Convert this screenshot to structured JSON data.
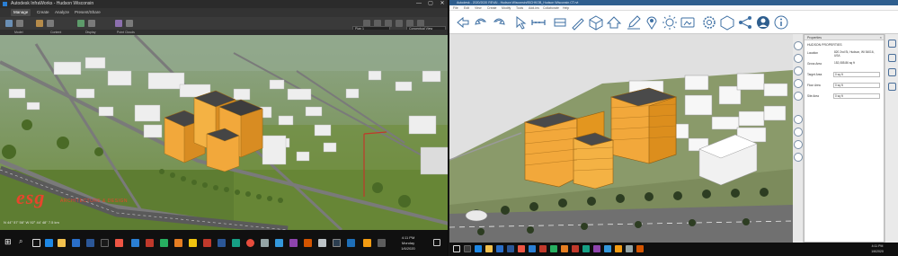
{
  "left_window": {
    "title": "Autodesk InfraWorks - Hudson Wisconsin",
    "tabs": [
      "Manage",
      "Create",
      "Analyze",
      "Present/Share"
    ],
    "ribbon_groups": [
      "Model",
      "Content",
      "Display",
      "Point Clouds"
    ],
    "view_select": "Plan 1",
    "style_select": "Conceptual View",
    "logo_text": "esg",
    "logo_subtitle": "ARCHITECTURE & DESIGN",
    "status_text": "N 44° 57' 56\" W 92° 44' 48\" 7.5 km",
    "clock_time": "4:11 PM",
    "clock_day": "Monday",
    "clock_date": "1/6/2020"
  },
  "right_window": {
    "title": "Autodesk - 2020/2020 REVAI - Hudson Wisconsin/IBCHKOB_Hudson Wisconsin.CT.rvt",
    "menu": [
      "File",
      "Edit",
      "View",
      "Create",
      "Modify",
      "Tools",
      "Add-ins",
      "Collaborate",
      "Help"
    ],
    "properties": {
      "panel_title": "Properties",
      "close": "×",
      "section_title": "HUDSON PROPERTIES",
      "rows": [
        {
          "label": "Location",
          "value": "820 2nd St, Hudson, WI 54016, USA",
          "plain": true
        },
        {
          "label": "Gross Area",
          "value": "152,085.86 sq ft",
          "plain": true
        },
        {
          "label": "Target Area",
          "value": "0 sq ft",
          "plain": false
        },
        {
          "label": "Floor Area",
          "value": "0 sq ft",
          "plain": false
        },
        {
          "label": "Site Area",
          "value": "0 sq ft",
          "plain": false
        }
      ]
    },
    "clock_time": "4:11 PM",
    "clock_date": "1/6/2020"
  },
  "colors": {
    "building_orange": "#f2a83b",
    "grass": "#6f8f3a",
    "road": "#6e6e6e",
    "left_chrome": "#2b2b2b",
    "right_title": "#2e5e8e"
  }
}
